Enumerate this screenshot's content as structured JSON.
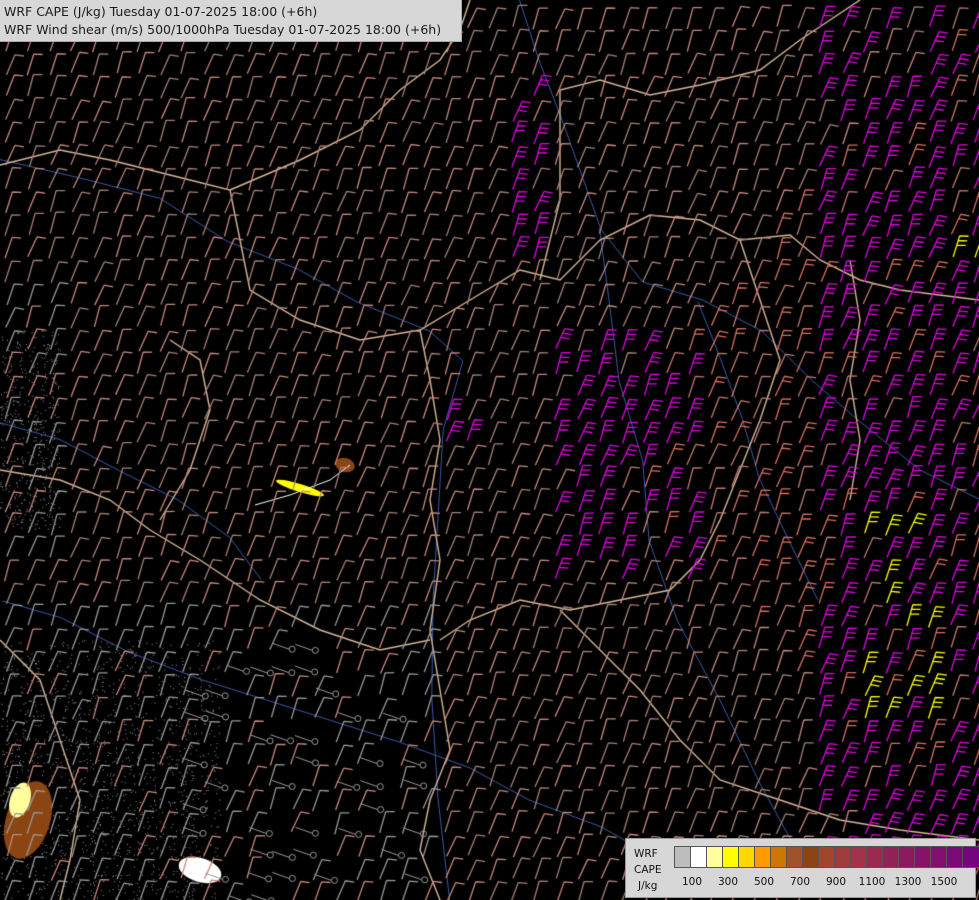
{
  "header": {
    "line1": "WRF CAPE (J/kg) Tuesday 01-07-2025 18:00 (+6h)",
    "line2": "WRF Wind shear (m/s) 500/1000hPa Tuesday 01-07-2025 18:00 (+6h)"
  },
  "legend": {
    "title1": "WRF",
    "title2": "CAPE",
    "unit": "J/kg",
    "colors": [
      "#bdbdbd",
      "#ffffff",
      "#ffff9e",
      "#ffff00",
      "#ffd700",
      "#ff9900",
      "#cc7700",
      "#a0522d",
      "#8b4513",
      "#a0442a",
      "#9e3b3b",
      "#a3324a",
      "#9b2a4f",
      "#912256",
      "#8b1a5e",
      "#861466",
      "#80106e",
      "#7a0a77",
      "#75057f"
    ],
    "ticks": [
      "100",
      "300",
      "500",
      "700",
      "900",
      "1100",
      "1300",
      "1500"
    ]
  },
  "map_data": {
    "region": "Pannonian Basin / Central Europe",
    "fields": [
      "CAPE shading",
      "wind shear barbs"
    ],
    "barb_colors": {
      "low": "#8c8c8c",
      "moderate": "#c98a7f",
      "high": "#d77060",
      "very_high": "#e000e0",
      "extreme": "#ffff00"
    }
  }
}
